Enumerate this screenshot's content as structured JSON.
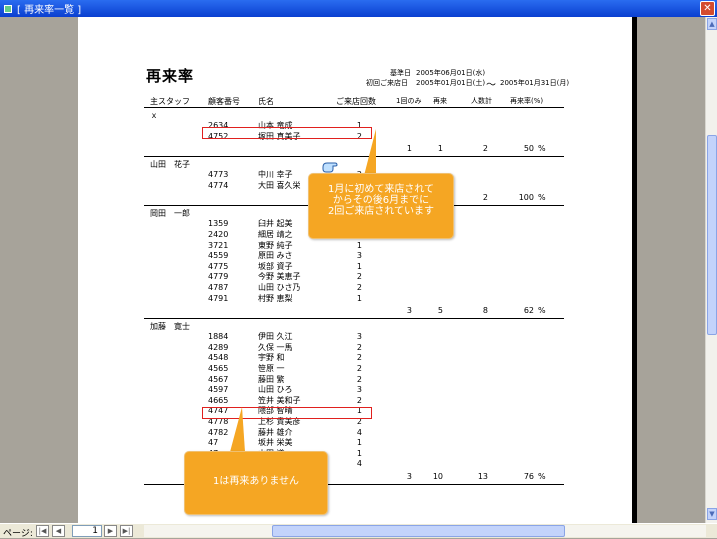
{
  "window": {
    "title": "[ 再来率一覧 ]",
    "close": "✕"
  },
  "report": {
    "title": "再来率",
    "base_date_label": "基準日",
    "base_date": "2005年06月01日(水)",
    "first_visit_label": "初回ご来店日",
    "first_visit_from": "2005年01月01日(土)",
    "tilde": "～",
    "first_visit_to": "2005年01月31日(月)",
    "columns": [
      "主スタッフ",
      "顧客番号",
      "氏名",
      "ご来店回数",
      "1回のみ",
      "再来",
      "人数計",
      "再来率(%)"
    ]
  },
  "groups": [
    {
      "staff": "ｘ",
      "rows": [
        {
          "id": "2634",
          "name": "山本 竜成",
          "count": "1"
        },
        {
          "id": "4752",
          "name": "塚田 真美子",
          "count": "2"
        }
      ],
      "summary": {
        "once": "1",
        "repeat": "1",
        "total": "2",
        "rate": "50",
        "pct": "%"
      }
    },
    {
      "staff": "山田　花子",
      "rows": [
        {
          "id": "4773",
          "name": "中川 幸子",
          "count": "2"
        },
        {
          "id": "4774",
          "name": "大田 喜久栄",
          "count": "2"
        }
      ],
      "summary": {
        "once": "",
        "repeat": "",
        "total": "2",
        "rate": "100",
        "pct": "%"
      }
    },
    {
      "staff": "岡田　一郎",
      "rows": [
        {
          "id": "1359",
          "name": "臼井 起美",
          "count": "2"
        },
        {
          "id": "2420",
          "name": "細居 靖之",
          "count": "2"
        },
        {
          "id": "3721",
          "name": "東野 純子",
          "count": "1"
        },
        {
          "id": "4559",
          "name": "原田 みさ",
          "count": "3"
        },
        {
          "id": "4775",
          "name": "坂部 資子",
          "count": "1"
        },
        {
          "id": "4779",
          "name": "今野 美恵子",
          "count": "2"
        },
        {
          "id": "4787",
          "name": "山田 ひさ乃",
          "count": "2"
        },
        {
          "id": "4791",
          "name": "村野 恵梨",
          "count": "1"
        }
      ],
      "summary": {
        "once": "3",
        "repeat": "5",
        "total": "8",
        "rate": "62",
        "pct": "%"
      }
    },
    {
      "staff": "加藤　寛士",
      "rows": [
        {
          "id": "1884",
          "name": "伊田 久江",
          "count": "3"
        },
        {
          "id": "4289",
          "name": "久保 一馬",
          "count": "2"
        },
        {
          "id": "4548",
          "name": "宇野 和",
          "count": "2"
        },
        {
          "id": "4565",
          "name": "笹原 一",
          "count": "2"
        },
        {
          "id": "4567",
          "name": "藤田 繁",
          "count": "2"
        },
        {
          "id": "4597",
          "name": "山田 ひろ",
          "count": "3"
        },
        {
          "id": "4665",
          "name": "笠井 美和子",
          "count": "2"
        },
        {
          "id": "4747",
          "name": "隈部 智晴",
          "count": "1"
        },
        {
          "id": "4778",
          "name": "上杉 貴美彦",
          "count": "2"
        },
        {
          "id": "4782",
          "name": "藤井 雄介",
          "count": "4"
        },
        {
          "id": "47",
          "name": "坂井 栄美",
          "count": "1"
        },
        {
          "id": "47",
          "name": "山田 道",
          "count": "1"
        },
        {
          "id": "47",
          "name": "横山 亘",
          "count": "4"
        }
      ],
      "summary": {
        "once": "3",
        "repeat": "10",
        "total": "13",
        "rate": "76",
        "pct": "%"
      }
    }
  ],
  "callouts": {
    "first": "1月に初めて来店されて\nからその後6月までに\n2回ご来店されています",
    "second": "1は再来ありません"
  },
  "status": {
    "page_label": "ページ:",
    "page_number": "1"
  },
  "colors": {
    "highlight": "#e0201e",
    "callout": "#f5a623",
    "titlebar": "#0a3fd0"
  }
}
